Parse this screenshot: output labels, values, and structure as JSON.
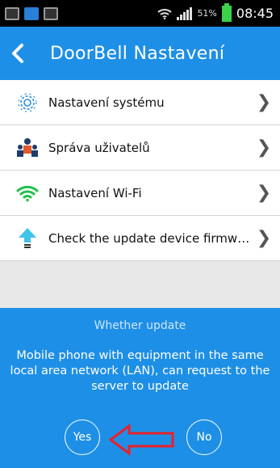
{
  "status_bar": {
    "battery": "51%",
    "time": "08:45",
    "icons": [
      "gallery-icon",
      "app-icon",
      "clipboard-icon",
      "wifi-icon",
      "signal-icon",
      "battery-icon"
    ]
  },
  "header": {
    "title": "DoorBell Nastavení",
    "back_icon": "chevron-left-icon",
    "color": "#1e8fe6"
  },
  "menu": {
    "items": [
      {
        "label": "Nastavení systému",
        "icon": "gear-icon"
      },
      {
        "label": "Správa uživatelů",
        "icon": "users-icon"
      },
      {
        "label": "Nastavení Wi-Fi",
        "icon": "wifi-icon"
      },
      {
        "label": "Check the update device firmware",
        "icon": "upload-arrow-icon"
      }
    ]
  },
  "dialog": {
    "title": "Whether update",
    "message": "Mobile phone with equipment in the same local area network (LAN), can request to the server to update",
    "yes_label": "Yes",
    "no_label": "No",
    "annotation": "red-arrow-pointing-to-yes"
  }
}
